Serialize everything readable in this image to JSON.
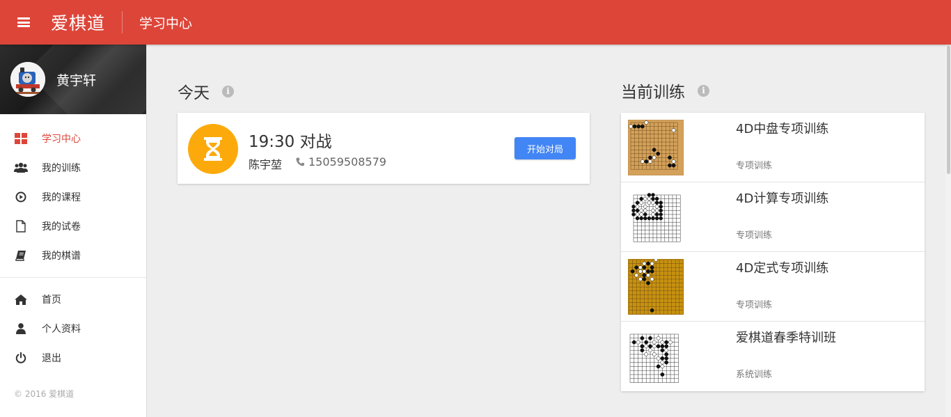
{
  "header": {
    "brand": "爱棋道",
    "page_title": "学习中心"
  },
  "profile": {
    "name": "黄宇轩"
  },
  "sidebar": {
    "main_items": [
      {
        "label": "学习中心",
        "icon": "dashboard-icon",
        "active": true
      },
      {
        "label": "我的训练",
        "icon": "users-icon"
      },
      {
        "label": "我的课程",
        "icon": "play-circle-icon"
      },
      {
        "label": "我的试卷",
        "icon": "file-icon"
      },
      {
        "label": "我的棋谱",
        "icon": "book-icon"
      }
    ],
    "secondary_items": [
      {
        "label": "首页",
        "icon": "home-icon"
      },
      {
        "label": "个人资料",
        "icon": "user-icon"
      },
      {
        "label": "退出",
        "icon": "power-icon"
      }
    ],
    "copyright": "© 2016 爱棋道"
  },
  "today": {
    "title": "今天",
    "event": {
      "title": "19:30 对战",
      "opponent": "陈宇堃",
      "phone": "15059508579",
      "button_label": "开始对局"
    }
  },
  "training": {
    "title": "当前训练",
    "items": [
      {
        "name": "4D中盘专项训练",
        "type": "专项训练"
      },
      {
        "name": "4D计算专项训练",
        "type": "专项训练"
      },
      {
        "name": "4D定式专项训练",
        "type": "专项训练"
      },
      {
        "name": "爱棋道春季特训班",
        "type": "系统训练"
      }
    ]
  },
  "colors": {
    "accent": "#dd4539",
    "button": "#4285f4",
    "hourglass": "#fcaa0b"
  }
}
